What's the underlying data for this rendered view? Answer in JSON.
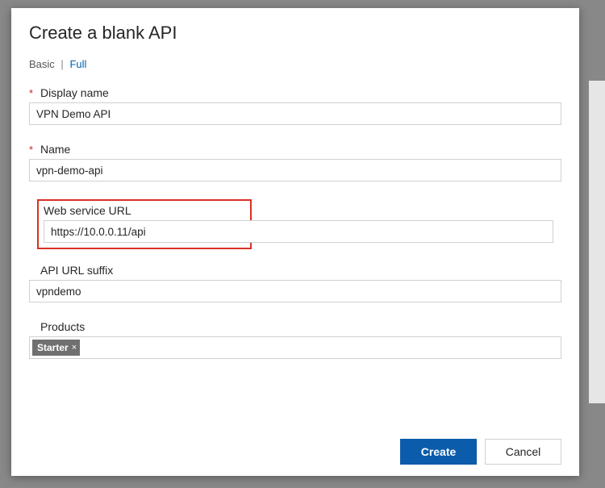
{
  "dialog": {
    "title": "Create a blank API",
    "view": {
      "basic": "Basic",
      "full": "Full"
    },
    "fields": {
      "display_name": {
        "label": "Display name",
        "value": "VPN Demo API"
      },
      "name": {
        "label": "Name",
        "value": "vpn-demo-api"
      },
      "web_service_url": {
        "label": "Web service URL",
        "value": "https://10.0.0.11/api"
      },
      "api_url_suffix": {
        "label": "API URL suffix",
        "value": "vpndemo"
      },
      "products": {
        "label": "Products",
        "tags": [
          "Starter"
        ]
      }
    },
    "buttons": {
      "create": "Create",
      "cancel": "Cancel"
    }
  }
}
